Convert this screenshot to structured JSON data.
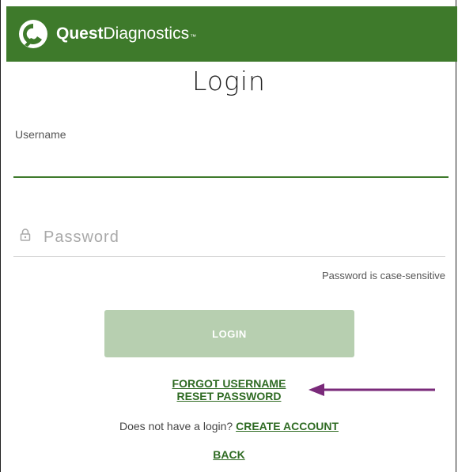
{
  "brand": {
    "name_bold": "Quest",
    "name_regular": "Diagnostics",
    "trademark": "™",
    "header_color": "#3e7a2b",
    "logo_icon": "quest-logo-icon"
  },
  "page": {
    "title": "Login"
  },
  "form": {
    "username_label": "Username",
    "username_value": "",
    "password_placeholder": "Password",
    "password_value": "",
    "password_icon": "lock-icon",
    "password_hint": "Password is case-sensitive",
    "login_label": "LOGIN",
    "login_button_color": "#b7cfb0"
  },
  "links": {
    "forgot_username": "FORGOT USERNAME",
    "reset_password": "RESET PASSWORD",
    "no_login_text": "Does not have a login?",
    "create_account": "CREATE ACCOUNT",
    "back": "BACK",
    "link_color": "#2f6b23"
  },
  "annotation": {
    "arrow_icon": "arrow-left-icon",
    "arrow_color": "#7a2a7a"
  }
}
